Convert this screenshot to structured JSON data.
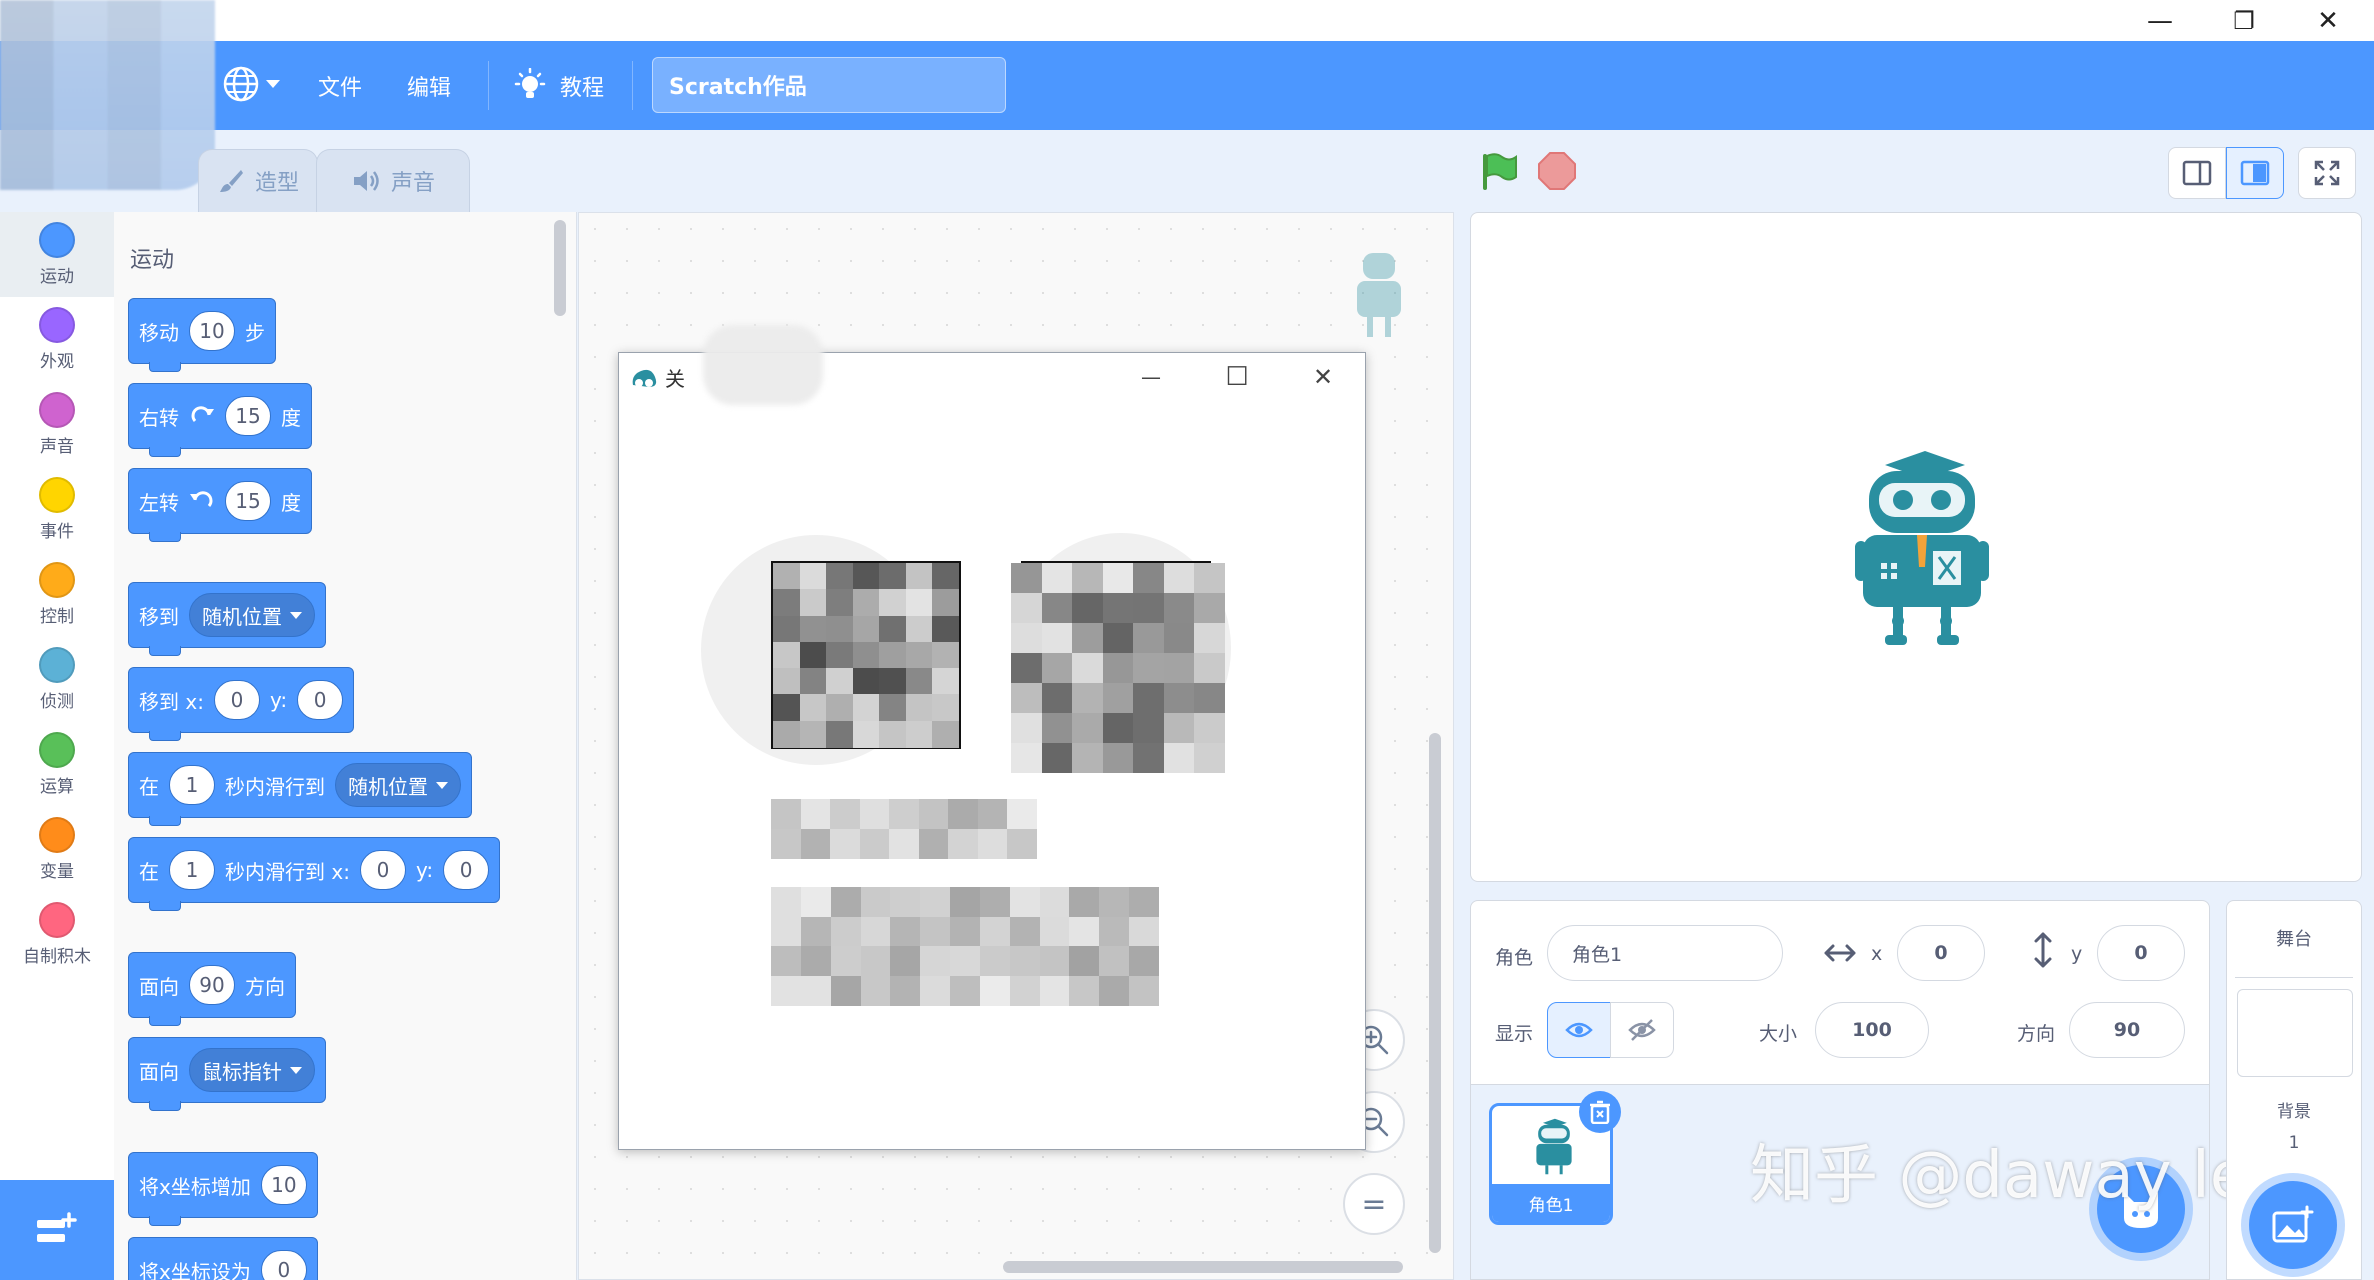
{
  "window": {
    "minimize": "—",
    "restore": "❐",
    "close": "✕"
  },
  "menu": {
    "file": "文件",
    "edit": "编辑",
    "tutorials": "教程",
    "project_title": "Scratch作品"
  },
  "tabs": {
    "costumes": "造型",
    "sounds": "声音"
  },
  "categories": [
    {
      "label": "运动",
      "color": "#4c97ff"
    },
    {
      "label": "外观",
      "color": "#9966ff"
    },
    {
      "label": "声音",
      "color": "#cf63cf"
    },
    {
      "label": "事件",
      "color": "#ffd500"
    },
    {
      "label": "控制",
      "color": "#ffab19"
    },
    {
      "label": "侦测",
      "color": "#5cb1d6"
    },
    {
      "label": "运算",
      "color": "#59c059"
    },
    {
      "label": "变量",
      "color": "#ff8c1a"
    },
    {
      "label": "自制积木",
      "color": "#ff6680"
    }
  ],
  "palette": {
    "heading": "运动",
    "move": {
      "a": "移动",
      "v": "10",
      "b": "步"
    },
    "turn_right": {
      "a": "右转",
      "v": "15",
      "b": "度"
    },
    "turn_left": {
      "a": "左转",
      "v": "15",
      "b": "度"
    },
    "goto": {
      "a": "移到",
      "dd": "随机位置"
    },
    "goto_xy": {
      "a": "移到 x:",
      "x": "0",
      "b": "y:",
      "y": "0"
    },
    "glide_to": {
      "a": "在",
      "v": "1",
      "b": "秒内滑行到",
      "dd": "随机位置"
    },
    "glide_xy": {
      "a": "在",
      "v": "1",
      "b": "秒内滑行到 x:",
      "x": "0",
      "c": "y:",
      "y": "0"
    },
    "point_dir": {
      "a": "面向",
      "v": "90",
      "b": "方向"
    },
    "point_towards": {
      "a": "面向",
      "dd": "鼠标指针"
    },
    "change_x": {
      "a": "将x坐标增加",
      "v": "10"
    },
    "set_x": {
      "a": "将x坐标设为",
      "v": "0"
    }
  },
  "dialog": {
    "title": "关",
    "minimize": "—",
    "maximize": "☐",
    "close": "✕"
  },
  "code_area": {
    "zoom_in": "+",
    "zoom_out": "−",
    "reset": "="
  },
  "sprite_info": {
    "sprite_label": "角色",
    "sprite_name": "角色1",
    "x_label": "x",
    "x": "0",
    "y_label": "y",
    "y": "0",
    "show_label": "显示",
    "size_label": "大小",
    "size": "100",
    "direction_label": "方向",
    "direction": "90"
  },
  "sprite_list": [
    {
      "name": "角色1"
    }
  ],
  "stage_pane": {
    "title": "舞台",
    "backdrops_label": "背景",
    "backdrops_count": "1"
  },
  "watermark": "知乎 @daway lee",
  "colors": {
    "accent": "#4c97ff",
    "flag": "#4cbf56",
    "stop": "#ec5959",
    "robot": "#2a8fa0"
  }
}
